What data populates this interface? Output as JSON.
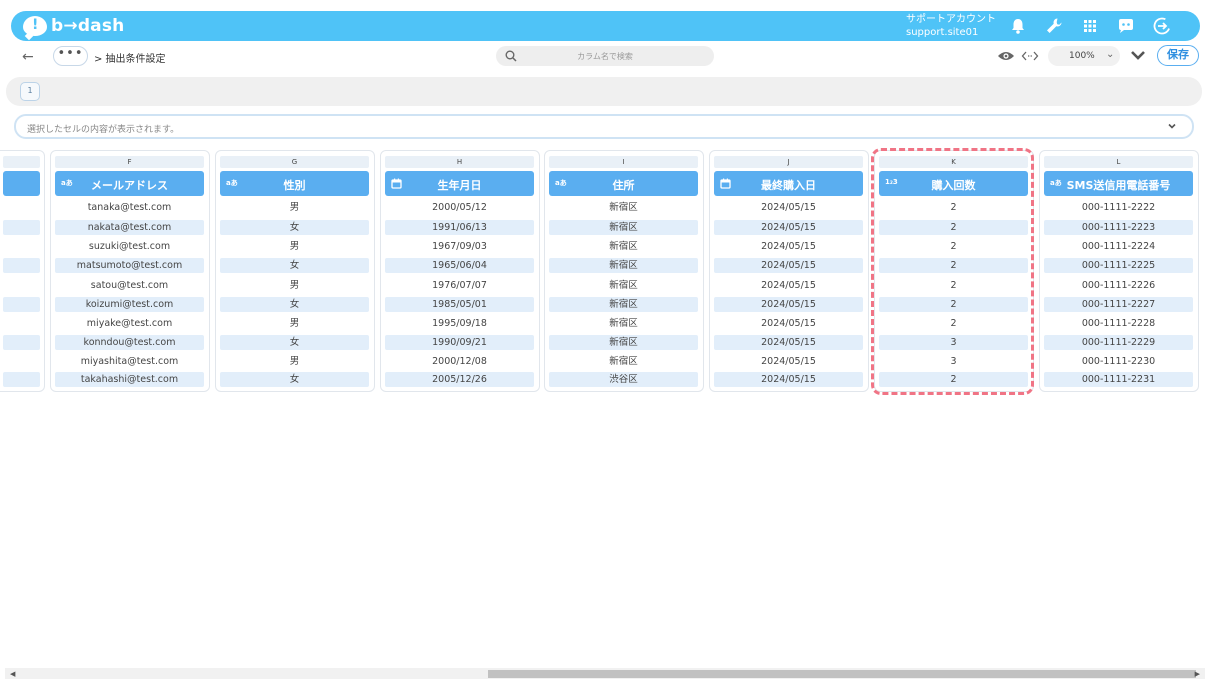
{
  "header": {
    "brand": "b→dash",
    "account_name": "サポートアカウント",
    "account_site": "support.site01",
    "icons": [
      "bell-icon",
      "wrench-icon",
      "grid-icon",
      "chat-bot-icon",
      "logout-icon"
    ]
  },
  "toolbar": {
    "more": "•••",
    "breadcrumb": "> 抽出条件設定",
    "search_placeholder": "カラム名で検索",
    "zoom": "100%",
    "save_label": "保存"
  },
  "pagebar": {
    "page": "1"
  },
  "preview": {
    "placeholder": "選択したセルの内容が表示されます。"
  },
  "columns": [
    {
      "letter": "F",
      "type_icon": "a-text-icon",
      "type_glyph": "aあ",
      "label": "メールアドレス",
      "cells": [
        "tanaka@test.com",
        "nakata@test.com",
        "suzuki@test.com",
        "matsumoto@test.com",
        "satou@test.com",
        "koizumi@test.com",
        "miyake@test.com",
        "konndou@test.com",
        "miyashita@test.com",
        "takahashi@test.com"
      ]
    },
    {
      "letter": "G",
      "type_icon": "a-text-icon",
      "type_glyph": "aあ",
      "label": "性別",
      "cells": [
        "男",
        "女",
        "男",
        "女",
        "男",
        "女",
        "男",
        "女",
        "男",
        "女"
      ]
    },
    {
      "letter": "H",
      "type_icon": "calendar-icon",
      "type_glyph": "",
      "label": "生年月日",
      "cells": [
        "2000/05/12",
        "1991/06/13",
        "1967/09/03",
        "1965/06/04",
        "1976/07/07",
        "1985/05/01",
        "1995/09/18",
        "1990/09/21",
        "2000/12/08",
        "2005/12/26"
      ]
    },
    {
      "letter": "I",
      "type_icon": "a-text-icon",
      "type_glyph": "aあ",
      "label": "住所",
      "cells": [
        "新宿区",
        "新宿区",
        "新宿区",
        "新宿区",
        "新宿区",
        "新宿区",
        "新宿区",
        "新宿区",
        "新宿区",
        "渋谷区"
      ]
    },
    {
      "letter": "J",
      "type_icon": "calendar-icon",
      "type_glyph": "",
      "label": "最終購入日",
      "cells": [
        "2024/05/15",
        "2024/05/15",
        "2024/05/15",
        "2024/05/15",
        "2024/05/15",
        "2024/05/15",
        "2024/05/15",
        "2024/05/15",
        "2024/05/15",
        "2024/05/15"
      ]
    },
    {
      "letter": "K",
      "type_icon": "number-icon",
      "type_glyph": "1₂3",
      "label": "購入回数",
      "cells": [
        "2",
        "2",
        "2",
        "2",
        "2",
        "2",
        "2",
        "3",
        "3",
        "2"
      ]
    },
    {
      "letter": "L",
      "type_icon": "a-text-icon",
      "type_glyph": "aあ",
      "label": "SMS送信用電話番号",
      "cells": [
        "000-1111-2222",
        "000-1111-2223",
        "000-1111-2224",
        "000-1111-2225",
        "000-1111-2226",
        "000-1111-2227",
        "000-1111-2228",
        "000-1111-2229",
        "000-1111-2230",
        "000-1111-2231"
      ]
    }
  ],
  "colors": {
    "header_bg": "#4fc3f7",
    "column_header": "#5aaef0",
    "row_alt": "#e2eefa",
    "highlight": "#f07485"
  }
}
